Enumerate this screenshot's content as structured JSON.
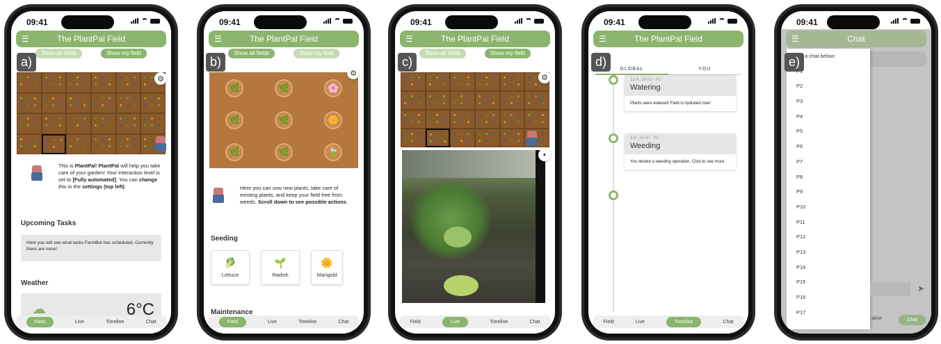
{
  "status": {
    "time": "09:41"
  },
  "phone_a": {
    "tag": "a)",
    "title": "The PlantPal Field",
    "show_all": "Show all fields",
    "show_my": "Show my field",
    "intro_1": "This is ",
    "intro_bold1": "PlantPal",
    "intro_2": "! ",
    "intro_bold2": "PlantPal",
    "intro_3": " will help you take care of your garden! Your interaction level is set to ",
    "intro_bold3": "[Fully automated]",
    "intro_4": ". You can ",
    "intro_bold4": "change",
    "intro_5": " this in the ",
    "intro_bold5": "settings (top left)",
    "intro_6": ".",
    "upcoming_title": "Upcoming Tasks",
    "upcoming_text": "Here you will see what tasks FarmBot has scheduled. Currently there are none!",
    "weather_title": "Weather",
    "temperature": "6°C",
    "nav": [
      "Field",
      "Live",
      "Timeline",
      "Chat"
    ]
  },
  "phone_b": {
    "tag": "b)",
    "title": "The PlantPal Field",
    "show_all": "Show all fields",
    "show_my": "Show my field",
    "intro": "Here you can sow new plants, take care of existing plants, and keep your field free from weeds. ",
    "intro_bold": "Scroll down to see possible actions",
    "intro_end": ".",
    "seeding_title": "Seeding",
    "seeds": [
      "Lettuce",
      "Radish",
      "Marigold"
    ],
    "maintenance_title": "Maintenance",
    "nav": [
      "Field",
      "Live",
      "Timeline",
      "Chat"
    ]
  },
  "phone_c": {
    "tag": "c)",
    "title": "The PlantPal Field",
    "show_all": "Show all fields",
    "show_my": "Show my field",
    "nav": [
      "Field",
      "Live",
      "Timeline",
      "Chat"
    ]
  },
  "phone_d": {
    "tag": "d)",
    "title": "The PlantPal Field",
    "tab_global": "GLOBAL",
    "tab_you": "YOU",
    "events": [
      {
        "meta": "12.9., 18:02 - P2",
        "title": "Watering",
        "body": "Plants were watered! Field is hydrated now!"
      },
      {
        "meta": "9.9., 18:00 - P2",
        "title": "Weeding",
        "body": "You denied a weeding operation. Click to see more."
      }
    ],
    "nav": [
      "Field",
      "Live",
      "Timeline",
      "Chat"
    ]
  },
  "phone_e": {
    "tag": "e)",
    "title": "Chat",
    "prompt": "a chat below:",
    "chats": [
      "P1",
      "P2",
      "P3",
      "P4",
      "P5",
      "P6",
      "P7",
      "P8",
      "P9",
      "P10",
      "P11",
      "P12",
      "P13",
      "P14",
      "P15",
      "P16",
      "P17"
    ],
    "nav_partial": "aline",
    "nav_chat": "Chat"
  },
  "colors": {
    "accent": "#8bb56d",
    "soil": "#8b5a2b"
  }
}
